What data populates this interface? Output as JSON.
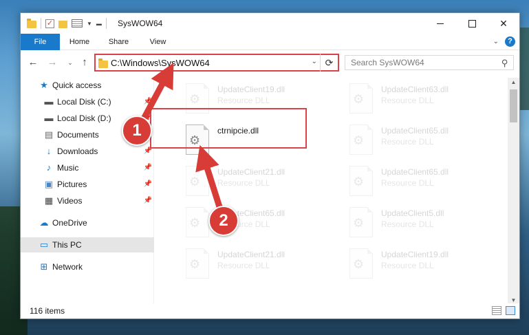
{
  "window": {
    "title": "SysWOW64",
    "controls": {
      "minimize": "",
      "maximize": "",
      "close": "✕"
    },
    "help": "?"
  },
  "ribbon": {
    "tabs": [
      {
        "label": "File"
      },
      {
        "label": "Home"
      },
      {
        "label": "Share"
      },
      {
        "label": "View"
      }
    ]
  },
  "address": {
    "path": "C:\\Windows\\SysWOW64",
    "refresh": "⟳"
  },
  "search": {
    "placeholder": "Search SysWOW64"
  },
  "sidebar": {
    "items": [
      {
        "label": "Quick access",
        "icon": "star-icon",
        "glyph": "★",
        "color": "#1979ca"
      },
      {
        "label": "Local Disk (C:)",
        "icon": "drive-icon",
        "glyph": "▬",
        "color": "#555555",
        "pinned": true
      },
      {
        "label": "Local Disk (D:)",
        "icon": "drive-icon",
        "glyph": "▬",
        "color": "#555555",
        "pinned": true
      },
      {
        "label": "Documents",
        "icon": "documents-icon",
        "glyph": "▤",
        "color": "#6a6a6a",
        "pinned": true
      },
      {
        "label": "Downloads",
        "icon": "download-icon",
        "glyph": "↓",
        "color": "#1979ca",
        "pinned": true
      },
      {
        "label": "Music",
        "icon": "music-icon",
        "glyph": "♪",
        "color": "#1979ca",
        "pinned": true
      },
      {
        "label": "Pictures",
        "icon": "pictures-icon",
        "glyph": "▣",
        "color": "#4a86c5",
        "pinned": true
      },
      {
        "label": "Videos",
        "icon": "video-icon",
        "glyph": "▦",
        "color": "#444444",
        "pinned": true
      },
      {
        "label": "OneDrive",
        "icon": "cloud-icon",
        "glyph": "☁",
        "color": "#1979ca"
      },
      {
        "label": "This PC",
        "icon": "computer-icon",
        "glyph": "▭",
        "color": "#1979ca",
        "selected": true
      },
      {
        "label": "Network",
        "icon": "network-icon",
        "glyph": "⊞",
        "color": "#1979ca"
      }
    ]
  },
  "files": {
    "left_col": [
      {
        "name": "UpdateClient19.dll",
        "type": "Resource DLL",
        "faded": true
      },
      {
        "name": "ctrnipcie.dll",
        "type": "",
        "faded": false
      },
      {
        "name": "UpdateClient21.dll",
        "type": "Resource DLL",
        "faded": true
      },
      {
        "name": "UpdateClient65.dll",
        "type": "Resource DLL",
        "faded": true
      },
      {
        "name": "UpdateClient21.dll",
        "type": "Resource DLL",
        "faded": true
      }
    ],
    "right_col": [
      {
        "name": "UpdateClient63.dll",
        "type": "Resource DLL",
        "faded": true
      },
      {
        "name": "UpdateClient65.dll",
        "type": "Resource DLL",
        "faded": true
      },
      {
        "name": "UpdateClient65.dll",
        "type": "Resource DLL",
        "faded": true
      },
      {
        "name": "UpdateClient5.dll",
        "type": "Resource DLL",
        "faded": true
      },
      {
        "name": "UpdateClient19.dll",
        "type": "Resource DLL",
        "faded": true
      }
    ]
  },
  "status": {
    "item_count": "116 items"
  },
  "annotations": {
    "badge1": "1",
    "badge2": "2",
    "accent_color": "#d9414b"
  }
}
